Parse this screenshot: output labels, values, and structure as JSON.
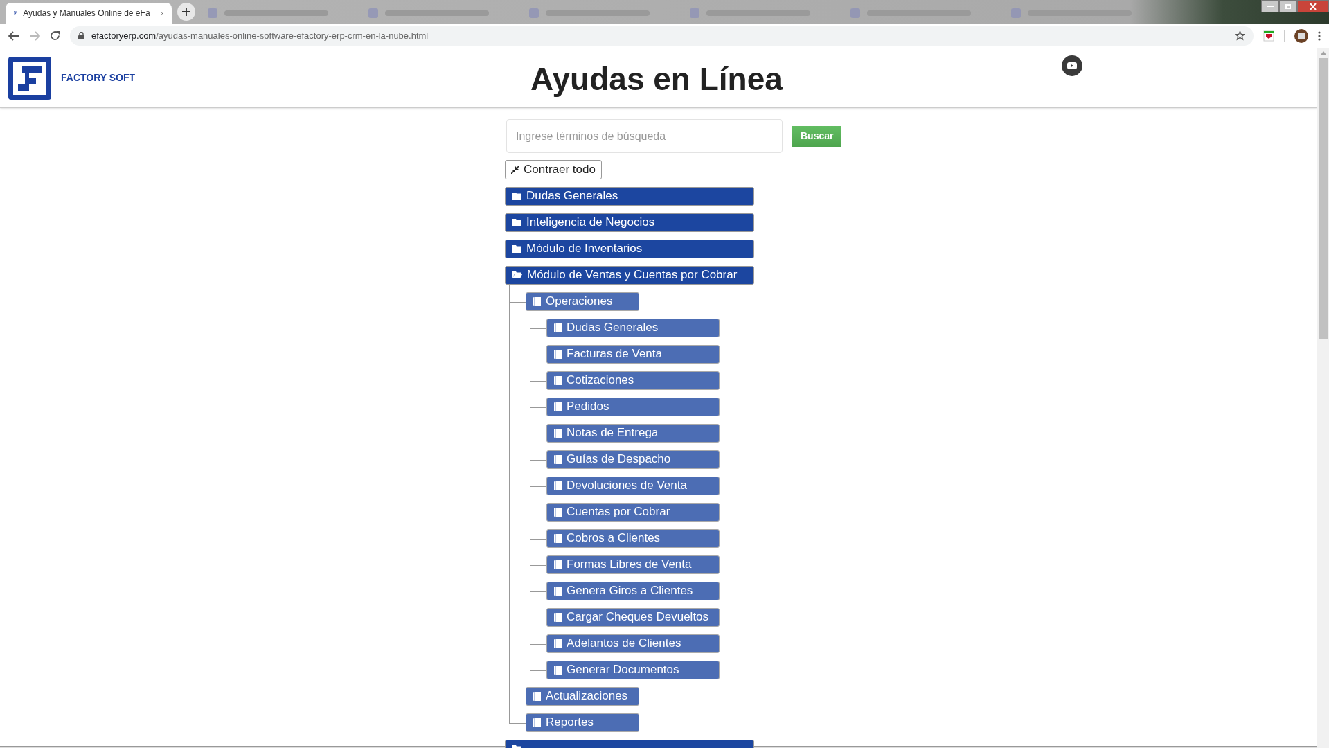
{
  "browser": {
    "tabs": [
      {
        "title": "Ayudas y Manuales Online de eFa",
        "selected": true
      },
      {
        "selected": false
      },
      {
        "selected": false
      },
      {
        "selected": false
      },
      {
        "selected": false
      },
      {
        "selected": false
      },
      {
        "selected": false
      }
    ],
    "address": {
      "domain": "efactoryerp.com",
      "path": "/ayudas-manuales-online-software-efactory-erp-crm-en-la-nube.html"
    }
  },
  "header": {
    "logo_text": "FACTORY SOFT",
    "title": "Ayudas en Línea"
  },
  "search": {
    "placeholder": "Ingrese términos de búsqueda",
    "button": "Buscar"
  },
  "collapse_button": "Contraer todo",
  "tree": [
    {
      "label": "Dudas Generales",
      "expanded": false
    },
    {
      "label": "Inteligencia de Negocios",
      "expanded": false
    },
    {
      "label": "Módulo de Inventarios",
      "expanded": false
    },
    {
      "label": "Módulo de Ventas y Cuentas por Cobrar",
      "expanded": true,
      "children": [
        {
          "label": "Operaciones",
          "expanded": true,
          "children": [
            {
              "label": "Dudas Generales"
            },
            {
              "label": "Facturas de Venta"
            },
            {
              "label": "Cotizaciones"
            },
            {
              "label": "Pedidos"
            },
            {
              "label": "Notas de Entrega"
            },
            {
              "label": "Guías de Despacho"
            },
            {
              "label": "Devoluciones de Venta"
            },
            {
              "label": "Cuentas por Cobrar"
            },
            {
              "label": "Cobros a Clientes"
            },
            {
              "label": "Formas Libres de Venta"
            },
            {
              "label": "Genera Giros a Clientes"
            },
            {
              "label": "Cargar Cheques Devueltos"
            },
            {
              "label": "Adelantos de Clientes"
            },
            {
              "label": "Generar Documentos"
            }
          ]
        },
        {
          "label": "Actualizaciones"
        },
        {
          "label": "Reportes"
        }
      ]
    },
    {
      "expanded": false
    }
  ]
}
